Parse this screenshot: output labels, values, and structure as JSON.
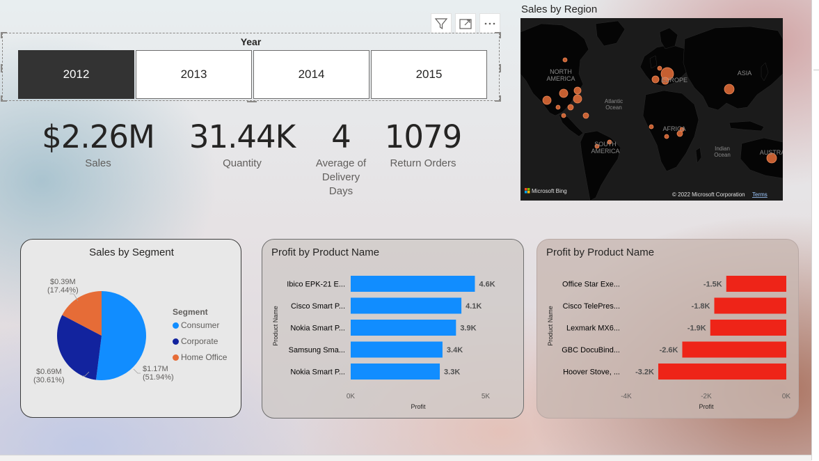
{
  "header_buttons": [
    {
      "icon": "filter-icon"
    },
    {
      "icon": "focus-mode-icon"
    },
    {
      "icon": "more-options-icon"
    }
  ],
  "slicer": {
    "title": "Year",
    "tiles": [
      "2012",
      "2013",
      "2014",
      "2015"
    ],
    "selected": "2012"
  },
  "kpis": {
    "sales": {
      "value": "$2.26M",
      "label": "Sales"
    },
    "quantity": {
      "value": "31.44K",
      "label": "Quantity"
    },
    "delivery": {
      "value": "4",
      "label_lines": [
        "Average of",
        "Delivery",
        "Days"
      ]
    },
    "returns": {
      "value": "1079",
      "label": "Return Orders"
    }
  },
  "map": {
    "title": "Sales by Region",
    "labels": {
      "north_america": [
        "NORTH",
        "AMERICA"
      ],
      "europe": "EUROPE",
      "asia": "ASIA",
      "atlantic": [
        "Atlantic",
        "Ocean"
      ],
      "africa": "AFRICA",
      "south_america": [
        "SOUTH",
        "AMERICA"
      ],
      "indian": [
        "Indian",
        "Ocean"
      ],
      "australia": "AUSTRA"
    },
    "bing_logo": "Microsoft Bing",
    "copyright": "© 2022 Microsoft Corporation",
    "terms": "Terms",
    "bubble_color": "#e8703a"
  },
  "pie": {
    "title": "Sales by Segment",
    "legend_title": "Segment",
    "segments": [
      {
        "name": "Consumer",
        "color": "#118dff"
      },
      {
        "name": "Corporate",
        "color": "#12239e"
      },
      {
        "name": "Home Office",
        "color": "#e66c37"
      }
    ],
    "labels": {
      "consumer": {
        "value": "$1.17M",
        "pct": "(51.94%)"
      },
      "corporate": {
        "value": "$0.69M",
        "pct": "(30.61%)"
      },
      "home_office": {
        "value": "$0.39M",
        "pct": "(17.44%)"
      }
    }
  },
  "chart_data": [
    {
      "type": "pie",
      "title": "Sales by Segment",
      "categories": [
        "Consumer",
        "Corporate",
        "Home Office"
      ],
      "values": [
        1.17,
        0.69,
        0.39
      ],
      "percentages": [
        51.94,
        30.61,
        17.44
      ],
      "unit": "$M",
      "legend": "right"
    },
    {
      "type": "bar",
      "orientation": "horizontal",
      "title": "Profit by Product Name",
      "categories": [
        "Ibico EPK-21 E...",
        "Cisco Smart P...",
        "Nokia Smart P...",
        "Samsung Sma...",
        "Nokia Smart P..."
      ],
      "values": [
        4600,
        4100,
        3900,
        3400,
        3300
      ],
      "value_labels": [
        "4.6K",
        "4.1K",
        "3.9K",
        "3.4K",
        "3.3K"
      ],
      "xlabel": "Profit",
      "ylabel": "Product Name",
      "xlim": [
        0,
        5000
      ],
      "xticks": [
        "0K",
        "5K"
      ],
      "color": "#118dff"
    },
    {
      "type": "bar",
      "orientation": "horizontal",
      "title": "Profit by Product Name",
      "categories": [
        "Office Star Exe...",
        "Cisco TelePres...",
        "Lexmark MX6...",
        "GBC DocuBind...",
        "Hoover Stove, ..."
      ],
      "values": [
        -1500,
        -1800,
        -1900,
        -2600,
        -3200
      ],
      "value_labels": [
        "-1.5K",
        "-1.8K",
        "-1.9K",
        "-2.6K",
        "-3.2K"
      ],
      "xlabel": "Profit",
      "ylabel": "Product Name",
      "xlim": [
        -4000,
        0
      ],
      "xticks": [
        "-4K",
        "-2K",
        "0K"
      ],
      "color": "#ee2418"
    }
  ]
}
